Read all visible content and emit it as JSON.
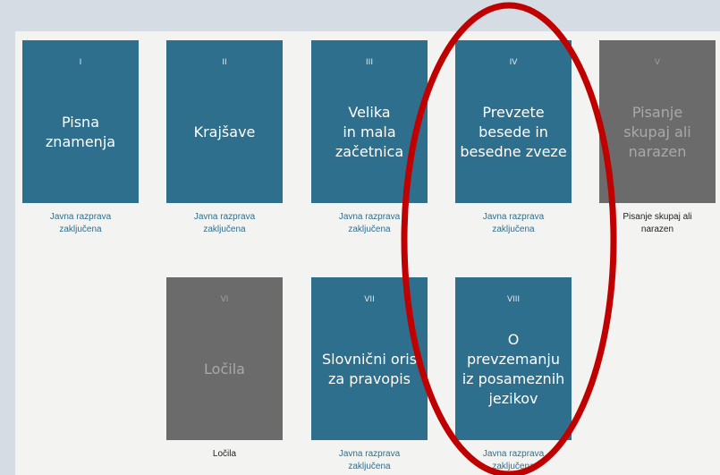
{
  "colors": {
    "card_blue": "#2e6f8e",
    "card_grey": "#6b6b6b",
    "highlight": "#c00000"
  },
  "cards": [
    {
      "num": "I",
      "title": "Pisna\nznamenja",
      "status": "Javna razprava\nzaključena"
    },
    {
      "num": "II",
      "title": "Krajšave",
      "status": "Javna razprava\nzaključena"
    },
    {
      "num": "III",
      "title": "Velika\nin mala\nzačetnica",
      "status": "Javna razprava\nzaključena"
    },
    {
      "num": "IV",
      "title": "Prevzete\nbesede in\nbesedne zveze",
      "status": "Javna razprava\nzaključena"
    },
    {
      "num": "V",
      "title": "Pisanje\nskupaj ali\nnarazen",
      "status": "Pisanje skupaj ali\nnarazen"
    },
    {
      "num": "VI",
      "title": "Ločila",
      "status": "Ločila"
    },
    {
      "num": "VII",
      "title": "Slovnični oris\nza pravopis",
      "status": "Javna razprava\nzaključena"
    },
    {
      "num": "VIII",
      "title": "O\nprevzemanju\niz posameznih\njezikov",
      "status": "Javna razprava\nzaključena"
    }
  ]
}
